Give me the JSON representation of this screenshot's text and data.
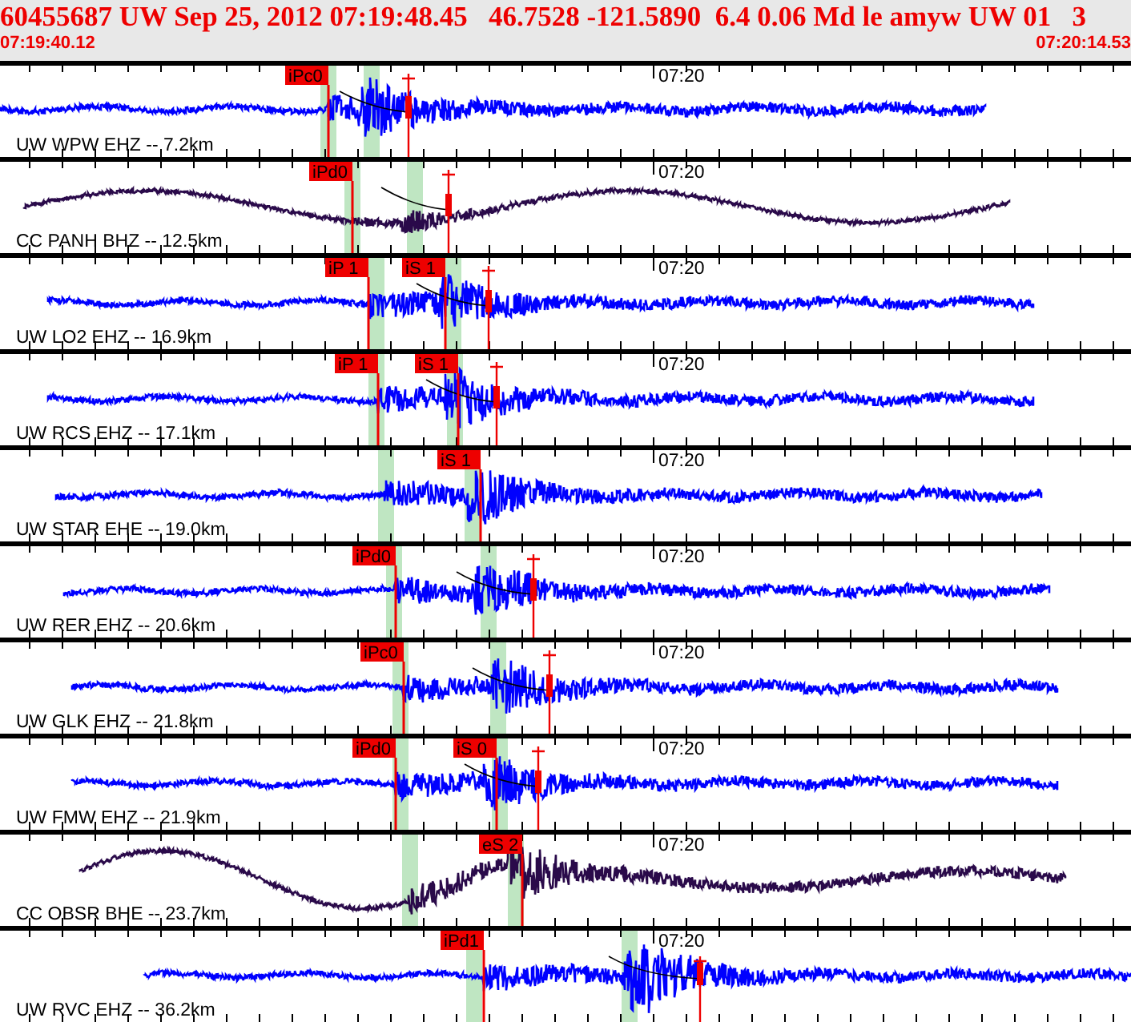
{
  "header": {
    "title": "60455687 UW Sep 25, 2012 07:19:48.45   46.7528 -121.5890  6.4 0.06 Md le amyw UW 01   3",
    "start_time": "07:19:40.12",
    "end_time": "07:20:14.53"
  },
  "traces": [
    {
      "station": "UW WPW EHZ -- 7.2km",
      "time_label": "07:20",
      "color": "#0000ff",
      "picks": [
        {
          "label": "iPc0"
        }
      ]
    },
    {
      "station": "CC PANH BHZ -- 12.5km",
      "time_label": "07:20",
      "color": "#2a0a4a",
      "picks": [
        {
          "label": "iPd0"
        }
      ]
    },
    {
      "station": "UW LO2 EHZ -- 16.9km",
      "time_label": "07:20",
      "color": "#0000ff",
      "picks": [
        {
          "label": "iP 1"
        },
        {
          "label": "iS 1"
        }
      ]
    },
    {
      "station": "UW RCS EHZ -- 17.1km",
      "time_label": "07:20",
      "color": "#0000ff",
      "picks": [
        {
          "label": "iP 1"
        },
        {
          "label": "iS 1"
        }
      ]
    },
    {
      "station": "UW STAR EHE -- 19.0km",
      "time_label": "07:20",
      "color": "#0000ff",
      "picks": [
        {
          "label": "iS 1"
        }
      ]
    },
    {
      "station": "UW RER EHZ -- 20.6km",
      "time_label": "07:20",
      "color": "#0000ff",
      "picks": [
        {
          "label": "iPd0"
        }
      ]
    },
    {
      "station": "UW GLK EHZ -- 21.8km",
      "time_label": "07:20",
      "color": "#0000ff",
      "picks": [
        {
          "label": "iPc0"
        }
      ]
    },
    {
      "station": "UW FMW EHZ -- 21.9km",
      "time_label": "07:20",
      "color": "#0000ff",
      "picks": [
        {
          "label": "iPd0"
        },
        {
          "label": "iS 0"
        }
      ]
    },
    {
      "station": "CC OBSR BHE -- 23.7km",
      "time_label": "07:20",
      "color": "#2a0a4a",
      "picks": [
        {
          "label": "eS 2"
        }
      ]
    },
    {
      "station": "UW RVC EHZ -- 36.2km",
      "time_label": "07:20",
      "color": "#0000ff",
      "picks": [
        {
          "label": "iPd1"
        }
      ]
    }
  ]
}
